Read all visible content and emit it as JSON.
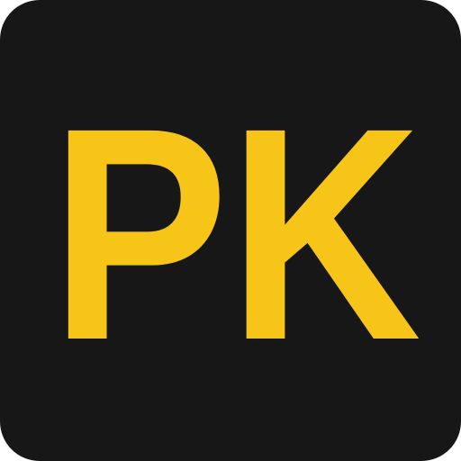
{
  "icon": {
    "monogram": "PK",
    "colors": {
      "background": "#171717",
      "accent": "#F6C518",
      "page": "#FFFFFF"
    }
  }
}
